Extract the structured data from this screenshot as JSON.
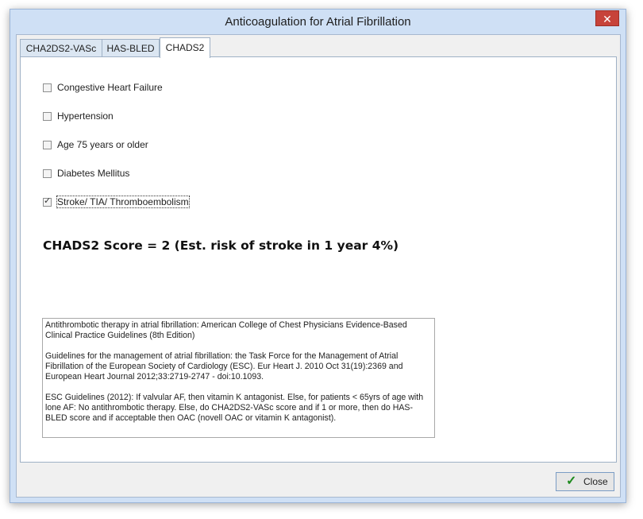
{
  "window": {
    "title": "Anticoagulation for Atrial Fibrillation",
    "close_glyph": "✕"
  },
  "tabs": [
    {
      "label": "CHA2DS2-VASc",
      "active": false
    },
    {
      "label": "HAS-BLED",
      "active": false
    },
    {
      "label": "CHADS2",
      "active": true
    }
  ],
  "criteria": [
    {
      "label": "Congestive Heart Failure",
      "checked": false
    },
    {
      "label": "Hypertension",
      "checked": false
    },
    {
      "label": "Age 75 years or older",
      "checked": false
    },
    {
      "label": "Diabetes Mellitus",
      "checked": false
    },
    {
      "label": "Stroke/ TIA/ Thromboembolism",
      "checked": true
    }
  ],
  "score_text": "CHADS2 Score = 2 (Est. risk of stroke in 1 year 4%)",
  "references": [
    "Antithrombotic therapy in atrial fibrillation: American College of Chest Physicians Evidence-Based Clinical Practice Guidelines (8th Edition)",
    "Guidelines for the management of atrial fibrillation: the Task Force for the Management of Atrial Fibrillation of the European Society of Cardiology (ESC). Eur Heart J. 2010 Oct 31(19):2369 and European Heart Journal 2012;33:2719-2747 - doi:10.1093.",
    "ESC Guidelines (2012):  If valvular AF, then vitamin K antagonist. Else, for patients < 65yrs of age with lone AF: No antithrombotic therapy. Else, do CHA2DS2-VASc score and if 1 or more, then do HAS-BLED score and if acceptable then OAC (novell OAC or vitamin K antagonist)."
  ],
  "close_button": {
    "label": "Close",
    "icon": "check-icon"
  },
  "checkmark_glyph": "✓"
}
